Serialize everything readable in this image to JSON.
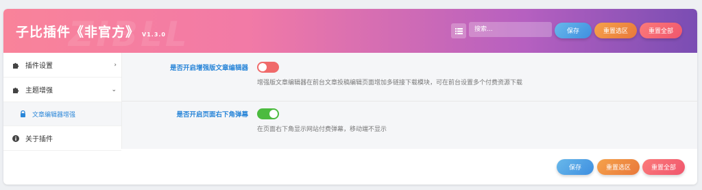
{
  "header": {
    "watermark": "ZIBLL",
    "title": "子比插件《非官方》",
    "version": "V1.3.0",
    "search_placeholder": "搜索...",
    "save_label": "保存",
    "reset_section_label": "重置选区",
    "reset_all_label": "重置全部"
  },
  "sidebar": {
    "items": [
      {
        "label": "插件设置",
        "icon": "puzzle-icon",
        "chevron": "›"
      },
      {
        "label": "主题增强",
        "icon": "puzzle-icon",
        "chevron": "⌄"
      },
      {
        "label": "文章编辑器增强",
        "icon": "lock-icon"
      },
      {
        "label": "关于插件",
        "icon": "info-icon"
      }
    ]
  },
  "settings": [
    {
      "label": "是否开启增强版文章编辑器",
      "enabled": false,
      "description": "增强版文章编辑器在前台文章投稿编辑页面增加多链接下载模块，可在前台设置多个付费资源下载"
    },
    {
      "label": "是否开启页面右下角弹幕",
      "enabled": true,
      "description": "在页面右下角显示网站付费弹幕，移动端不显示"
    }
  ],
  "footer": {
    "save_label": "保存",
    "reset_section_label": "重置选区",
    "reset_all_label": "重置全部"
  },
  "colors": {
    "accent_blue": "#2a86d8",
    "toggle_off": "#f06a6a",
    "toggle_on": "#4cbb3f"
  }
}
